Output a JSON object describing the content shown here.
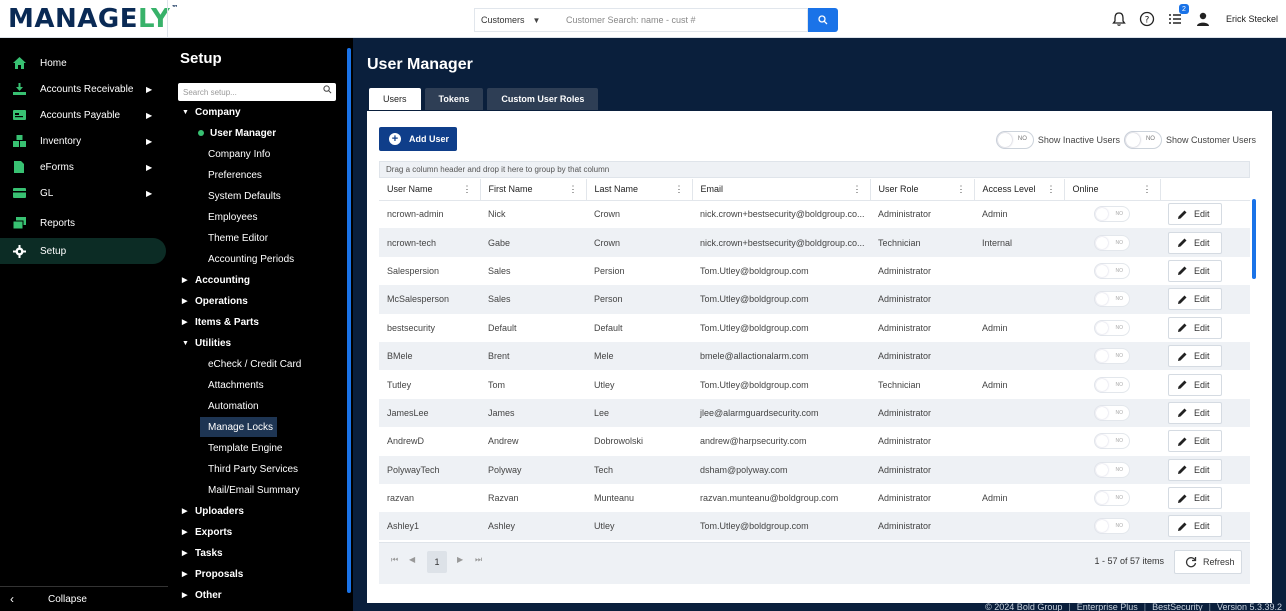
{
  "header": {
    "logo_main": "MANAGE",
    "logo_y": "LY",
    "logo_tm": "™",
    "search_type": "Customers",
    "search_placeholder": "Customer Search: name - cust #",
    "notification_count": "2",
    "user_name": "Erick Steckel"
  },
  "nav": {
    "items": [
      {
        "label": "Home",
        "icon": "home-icon",
        "arrow": false
      },
      {
        "label": "Accounts Receivable",
        "icon": "receivable-icon",
        "arrow": true
      },
      {
        "label": "Accounts Payable",
        "icon": "payable-icon",
        "arrow": true
      },
      {
        "label": "Inventory",
        "icon": "inventory-icon",
        "arrow": true
      },
      {
        "label": "eForms",
        "icon": "eforms-icon",
        "arrow": true
      },
      {
        "label": "GL",
        "icon": "gl-icon",
        "arrow": true
      },
      {
        "label": "Reports",
        "icon": "reports-icon",
        "arrow": false
      },
      {
        "label": "Setup",
        "icon": "gear-icon",
        "arrow": false
      }
    ],
    "collapse_label": "Collapse"
  },
  "setup": {
    "title": "Setup",
    "search_placeholder": "Search setup...",
    "tree": {
      "company": "Company",
      "user_manager": "User Manager",
      "company_info": "Company Info",
      "preferences": "Preferences",
      "system_defaults": "System Defaults",
      "employees": "Employees",
      "theme_editor": "Theme Editor",
      "accounting_periods": "Accounting Periods",
      "accounting": "Accounting",
      "operations": "Operations",
      "items_parts": "Items & Parts",
      "utilities": "Utilities",
      "echeck": "eCheck / Credit Card",
      "attachments": "Attachments",
      "automation": "Automation",
      "manage_locks": "Manage Locks",
      "template_engine": "Template Engine",
      "third_party": "Third Party Services",
      "mail_summary": "Mail/Email Summary",
      "uploaders": "Uploaders",
      "exports": "Exports",
      "tasks": "Tasks",
      "proposals": "Proposals",
      "other": "Other"
    }
  },
  "main": {
    "title": "User Manager",
    "tabs": [
      "Users",
      "Tokens",
      "Custom User Roles"
    ],
    "add_user_label": "Add User",
    "toggle_off_text": "NO",
    "show_inactive_label": "Show Inactive Users",
    "show_customer_label": "Show Customer Users",
    "group_hint": "Drag a column header and drop it here to group by that column",
    "columns": [
      "User Name",
      "First Name",
      "Last Name",
      "Email",
      "User Role",
      "Access Level",
      "Online"
    ],
    "edit_label": "Edit",
    "rows": [
      {
        "user": "ncrown-admin",
        "first": "Nick",
        "last": "Crown",
        "email": "nick.crown+bestsecurity@boldgroup.co...",
        "role": "Administrator",
        "access": "Admin"
      },
      {
        "user": "ncrown-tech",
        "first": "Gabe",
        "last": "Crown",
        "email": "nick.crown+bestsecurity@boldgroup.co...",
        "role": "Technician",
        "access": "Internal"
      },
      {
        "user": "Salespersion",
        "first": "Sales",
        "last": "Persion",
        "email": "Tom.Utley@boldgroup.com",
        "role": "Administrator",
        "access": ""
      },
      {
        "user": "McSalesperson",
        "first": "Sales",
        "last": "Person",
        "email": "Tom.Utley@boldgroup.com",
        "role": "Administrator",
        "access": ""
      },
      {
        "user": "bestsecurity",
        "first": "Default",
        "last": "Default",
        "email": "Tom.Utley@boldgroup.com",
        "role": "Administrator",
        "access": "Admin"
      },
      {
        "user": "BMele",
        "first": "Brent",
        "last": "Mele",
        "email": "bmele@allactionalarm.com",
        "role": "Administrator",
        "access": ""
      },
      {
        "user": "Tutley",
        "first": "Tom",
        "last": "Utley",
        "email": "Tom.Utley@boldgroup.com",
        "role": "Technician",
        "access": "Admin"
      },
      {
        "user": "JamesLee",
        "first": "James",
        "last": "Lee",
        "email": "jlee@alarmguardsecurity.com",
        "role": "Administrator",
        "access": ""
      },
      {
        "user": "AndrewD",
        "first": "Andrew",
        "last": "Dobrowolski",
        "email": "andrew@harpsecurity.com",
        "role": "Administrator",
        "access": ""
      },
      {
        "user": "PolywayTech",
        "first": "Polyway",
        "last": "Tech",
        "email": "dsham@polyway.com",
        "role": "Administrator",
        "access": ""
      },
      {
        "user": "razvan",
        "first": "Razvan",
        "last": "Munteanu",
        "email": "razvan.munteanu@boldgroup.com",
        "role": "Administrator",
        "access": "Admin"
      },
      {
        "user": "Ashley1",
        "first": "Ashley",
        "last": "Utley",
        "email": "Tom.Utley@boldgroup.com",
        "role": "Administrator",
        "access": ""
      }
    ],
    "pager": {
      "current_page": "1",
      "info": "1 - 57 of 57 items",
      "refresh_label": "Refresh"
    }
  },
  "footer": {
    "copyright": "© 2024 Bold Group",
    "edition": "Enterprise Plus",
    "company": "BestSecurity",
    "version": "Version 5.3.39.2"
  },
  "colors": {
    "brand_navy": "#0a2a55",
    "brand_green": "#38b26a",
    "accent_blue": "#1a73e8",
    "page_bg": "#0a1f3c"
  }
}
